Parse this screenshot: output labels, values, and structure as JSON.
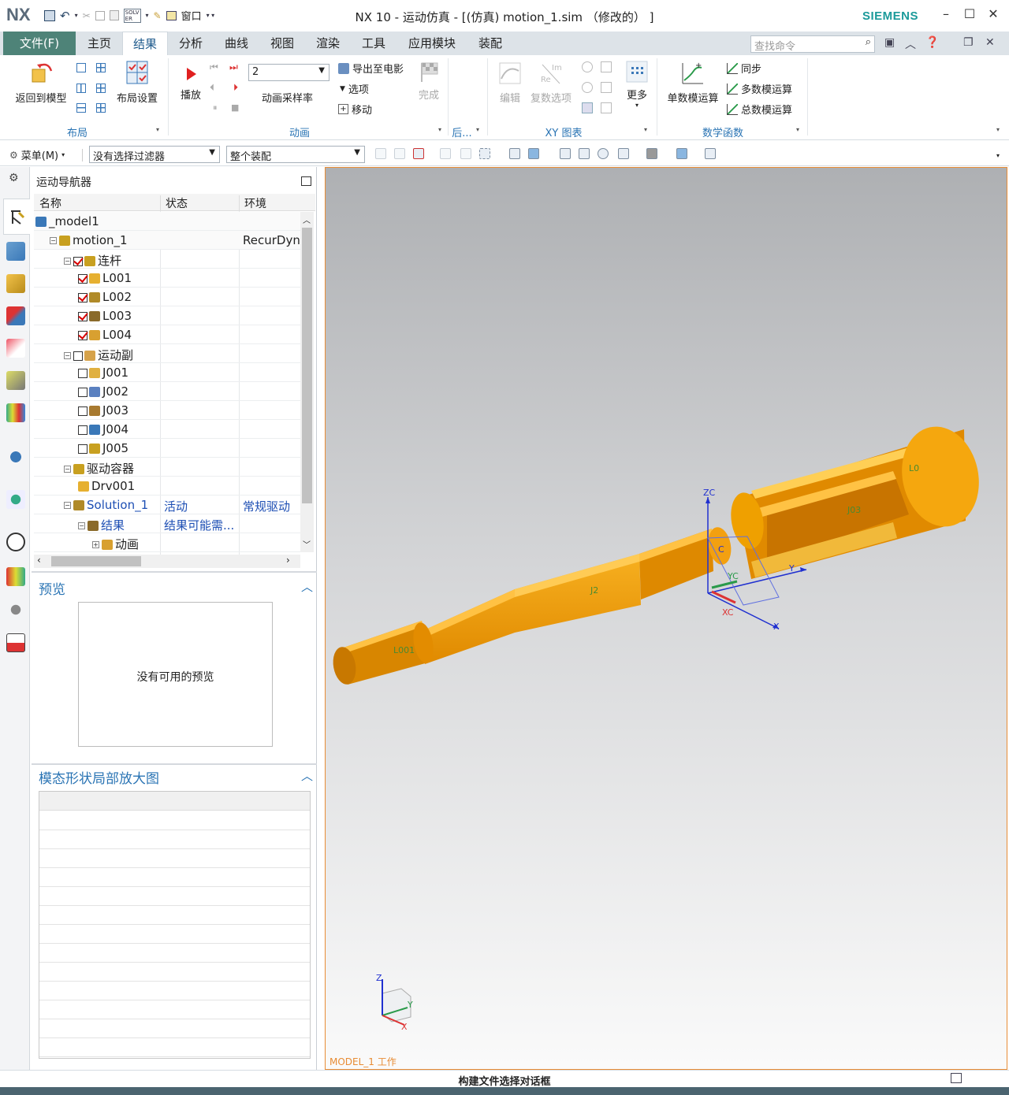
{
  "app": {
    "logo": "NX",
    "window_title": "NX 10 - 运动仿真 - [(仿真) motion_1.sim （修改的） ]",
    "brand": "SIEMENS",
    "window_menu": "窗口",
    "brand_color": "#1b9a9a",
    "accent": "#4e8378"
  },
  "menubar": {
    "file": "文件(F)",
    "tabs": [
      "主页",
      "结果",
      "分析",
      "曲线",
      "视图",
      "渲染",
      "工具",
      "应用模块",
      "装配"
    ],
    "active_tab": "结果",
    "search_placeholder": "查找命令"
  },
  "ribbon": {
    "layout": {
      "back_to_model": "返回到模型",
      "layout_settings": "布局设置",
      "group": "布局"
    },
    "animation": {
      "play": "播放",
      "sample_value": "2",
      "sample_rate": "动画采样率",
      "export_movie": "导出至电影",
      "options": "选项",
      "move": "移动",
      "finish": "完成",
      "group": "动画",
      "post_group": "后..."
    },
    "xy": {
      "edit": "编辑",
      "complex_options": "复数选项",
      "more": "更多",
      "group": "XY 图表"
    },
    "math": {
      "single": "单数模运算",
      "sync": "同步",
      "multi": "多数模运算",
      "total": "总数模运算",
      "group": "数学函数"
    }
  },
  "toolbar2": {
    "menu": "菜单(M)",
    "filter": "没有选择过滤器",
    "scope": "整个装配"
  },
  "navigator": {
    "title": "运动导航器",
    "columns": [
      "名称",
      "状态",
      "环境"
    ],
    "rows": [
      {
        "name": "_model1",
        "status": "",
        "env": "",
        "indent": 0,
        "check": "",
        "exp": "",
        "blue": false
      },
      {
        "name": "motion_1",
        "status": "",
        "env": "RecurDyn",
        "indent": 1,
        "check": "",
        "exp": "−",
        "blue": false
      },
      {
        "name": "连杆",
        "status": "",
        "env": "",
        "indent": 2,
        "check": "on",
        "exp": "−",
        "blue": false
      },
      {
        "name": "L001",
        "status": "",
        "env": "",
        "indent": 3,
        "check": "on",
        "exp": "",
        "blue": false
      },
      {
        "name": "L002",
        "status": "",
        "env": "",
        "indent": 3,
        "check": "on",
        "exp": "",
        "blue": false
      },
      {
        "name": "L003",
        "status": "",
        "env": "",
        "indent": 3,
        "check": "on",
        "exp": "",
        "blue": false
      },
      {
        "name": "L004",
        "status": "",
        "env": "",
        "indent": 3,
        "check": "on",
        "exp": "",
        "blue": false
      },
      {
        "name": "运动副",
        "status": "",
        "env": "",
        "indent": 2,
        "check": "off",
        "exp": "−",
        "blue": false
      },
      {
        "name": "J001",
        "status": "",
        "env": "",
        "indent": 3,
        "check": "off",
        "exp": "",
        "blue": false
      },
      {
        "name": "J002",
        "status": "",
        "env": "",
        "indent": 3,
        "check": "off",
        "exp": "",
        "blue": false
      },
      {
        "name": "J003",
        "status": "",
        "env": "",
        "indent": 3,
        "check": "off",
        "exp": "",
        "blue": false
      },
      {
        "name": "J004",
        "status": "",
        "env": "",
        "indent": 3,
        "check": "off",
        "exp": "",
        "blue": false
      },
      {
        "name": "J005",
        "status": "",
        "env": "",
        "indent": 3,
        "check": "off",
        "exp": "",
        "blue": false
      },
      {
        "name": "驱动容器",
        "status": "",
        "env": "",
        "indent": 2,
        "check": "",
        "exp": "−",
        "blue": false
      },
      {
        "name": "Drv001",
        "status": "",
        "env": "",
        "indent": 3,
        "check": "",
        "exp": "",
        "blue": false
      },
      {
        "name": "Solution_1",
        "status": "活动",
        "env": "常规驱动",
        "indent": 2,
        "check": "",
        "exp": "−",
        "blue": true
      },
      {
        "name": "结果",
        "status": "结果可能需...",
        "env": "",
        "indent": 3,
        "check": "",
        "exp": "−",
        "blue": true
      },
      {
        "name": "动画",
        "status": "",
        "env": "",
        "indent": 4,
        "check": "",
        "exp": "+",
        "blue": false
      }
    ]
  },
  "preview": {
    "title": "预览",
    "empty": "没有可用的预览"
  },
  "modal": {
    "title": "模态形状局部放大图"
  },
  "viewport": {
    "label": "MODEL_1 工作",
    "part_labels": [
      "L001",
      "J2",
      "J03",
      "L0"
    ],
    "axes": {
      "zc": "ZC",
      "yc": "YC",
      "xc": "XC",
      "x": "X",
      "y": "Y",
      "z": "Z",
      "origin": "C"
    }
  },
  "status": {
    "message": "构建文件选择对话框"
  }
}
